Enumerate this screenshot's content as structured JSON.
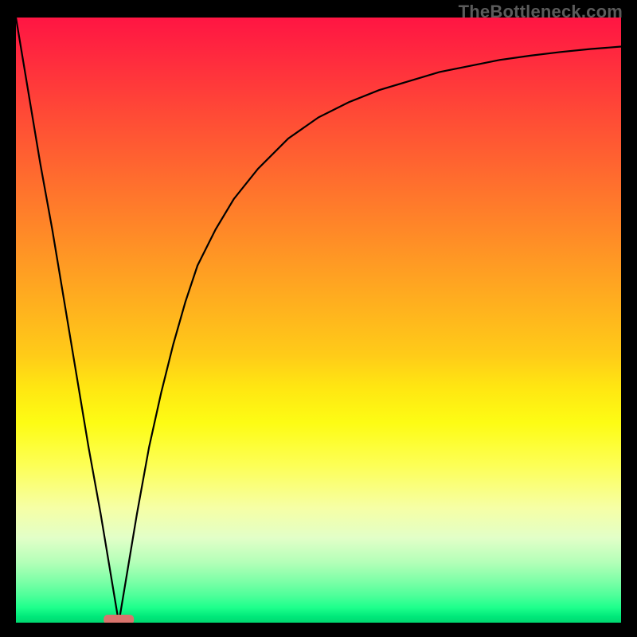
{
  "watermark": "TheBottleneck.com",
  "colors": {
    "frame": "#000000",
    "curve": "#000000",
    "marker": "#d9746d",
    "gradient_top": "#ff1543",
    "gradient_bottom": "#00d870"
  },
  "chart_data": {
    "type": "line",
    "title": "",
    "xlabel": "",
    "ylabel": "",
    "xlim": [
      0,
      100
    ],
    "ylim": [
      0,
      100
    ],
    "grid": false,
    "legend": false,
    "marker_x": 17,
    "x": [
      0,
      2,
      4,
      6,
      8,
      10,
      12,
      14,
      15,
      16,
      17,
      18,
      19,
      20,
      22,
      24,
      26,
      28,
      30,
      33,
      36,
      40,
      45,
      50,
      55,
      60,
      65,
      70,
      75,
      80,
      85,
      90,
      95,
      100
    ],
    "y": [
      100,
      88,
      76,
      65,
      53,
      41,
      29,
      18,
      12,
      6,
      0,
      6,
      12,
      18,
      29,
      38,
      46,
      53,
      59,
      65,
      70,
      75,
      80,
      83.5,
      86,
      88,
      89.5,
      91,
      92,
      93,
      93.7,
      94.3,
      94.8,
      95.2
    ]
  }
}
